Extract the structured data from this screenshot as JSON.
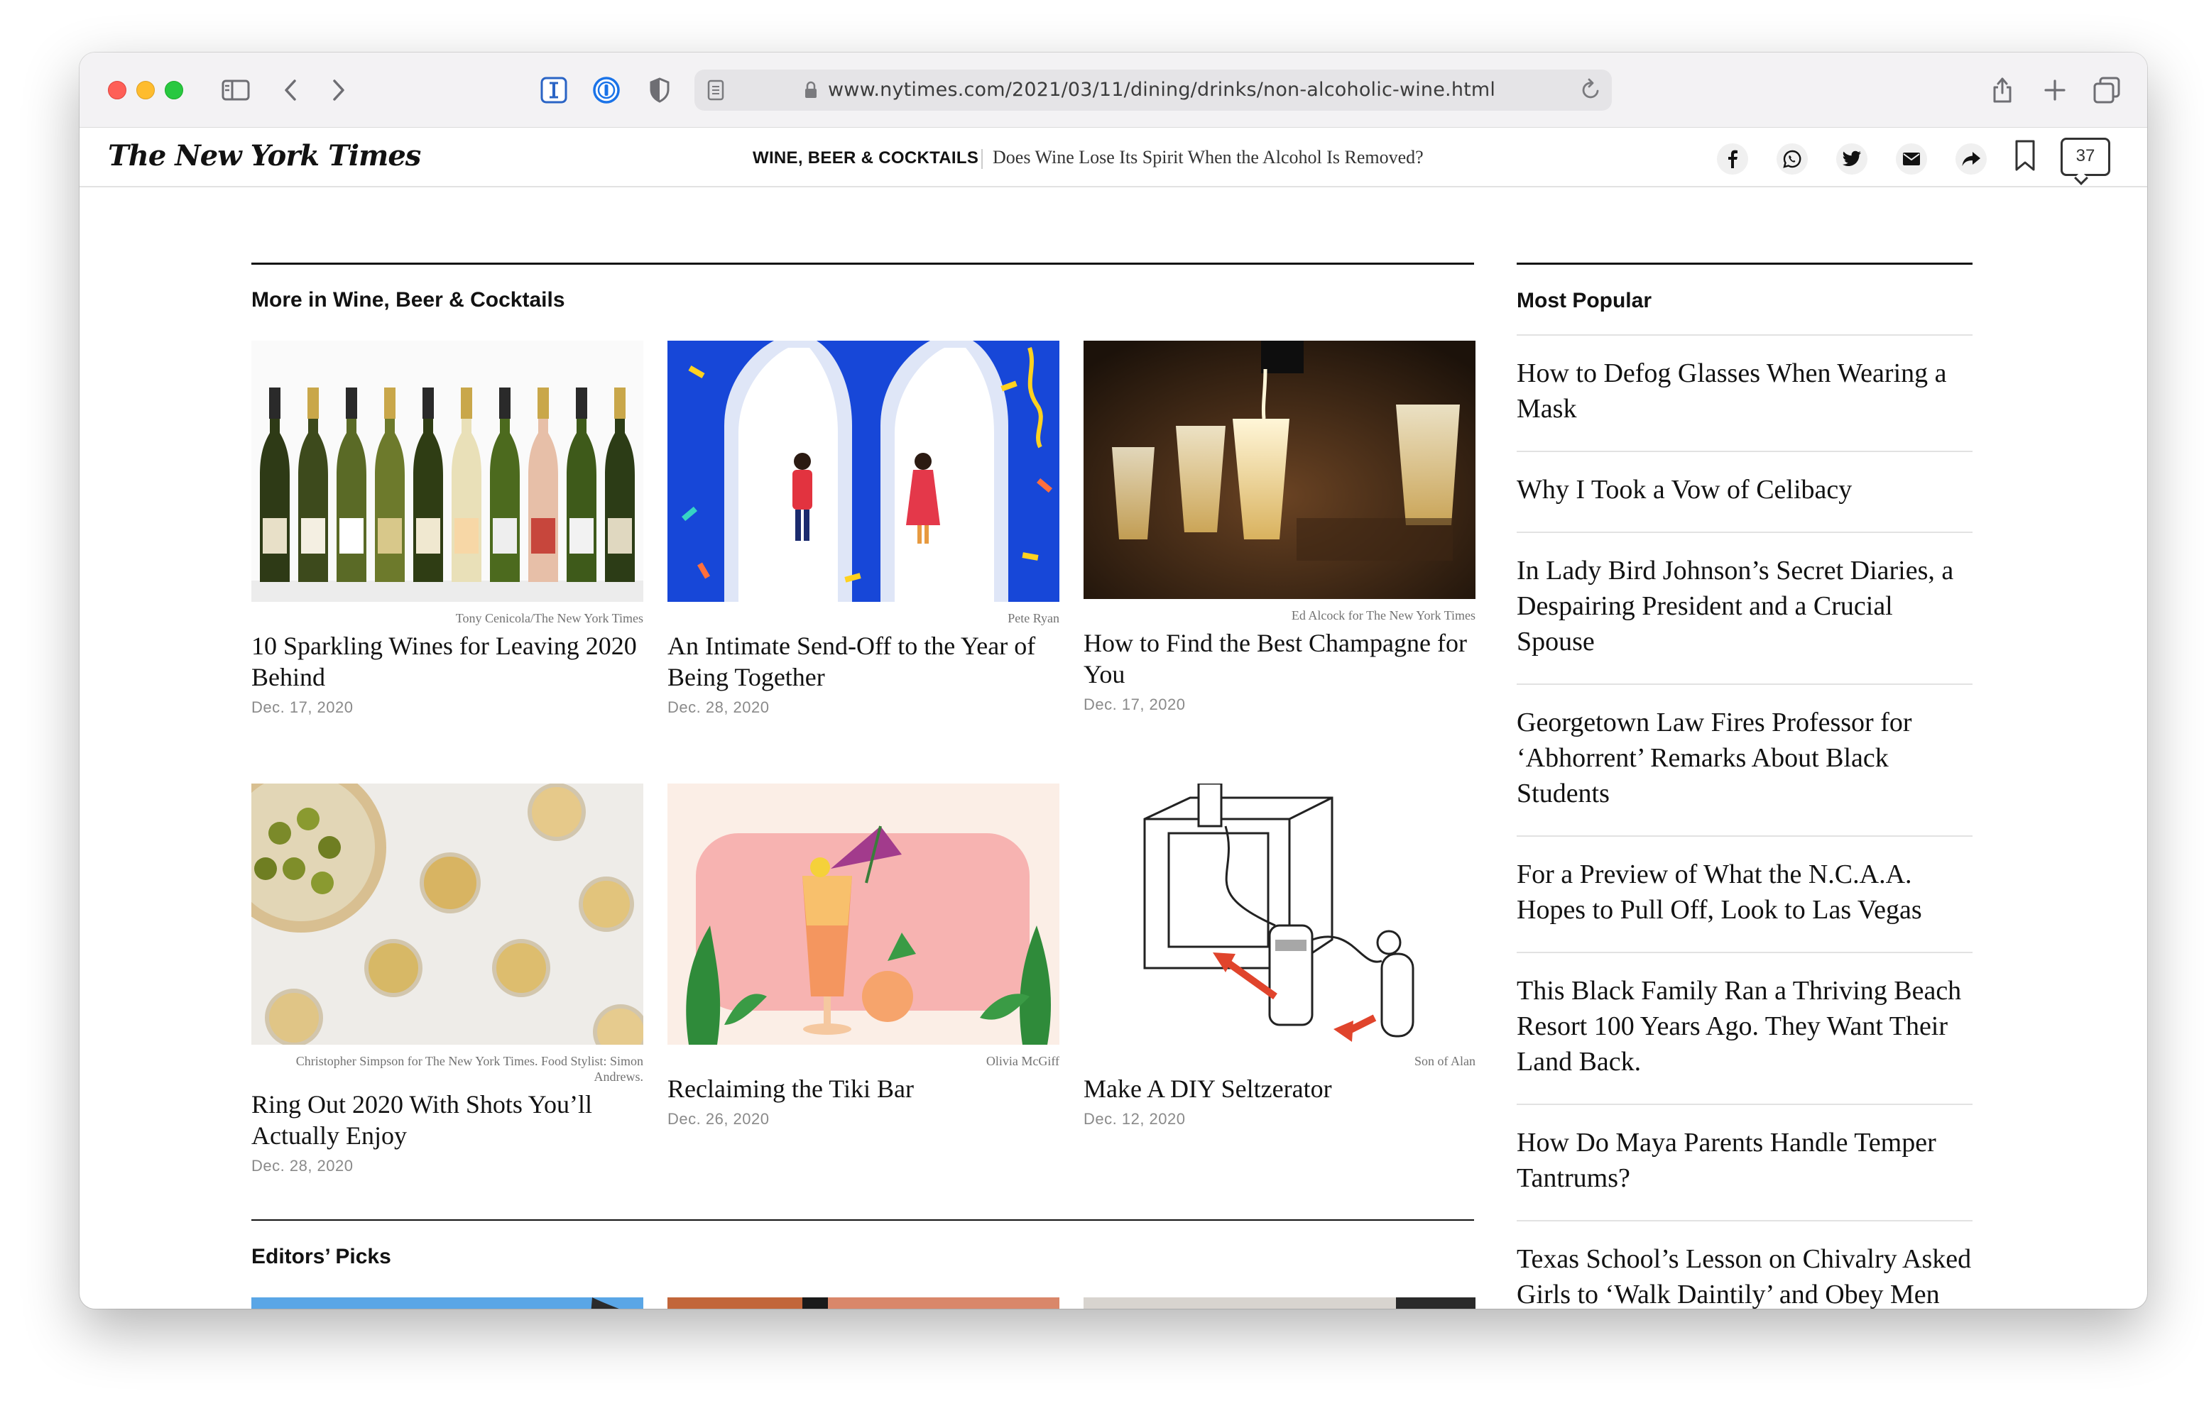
{
  "browser": {
    "url": "www.nytimes.com/2021/03/11/dining/drinks/non-alcoholic-wine.html"
  },
  "header": {
    "logo": "The New York Times",
    "section": "WINE, BEER & COCKTAILS",
    "headline": "Does Wine Lose Its Spirit When the Alcohol Is Removed?",
    "comment_count": "37"
  },
  "more_section": {
    "title": "More in Wine, Beer & Cocktails",
    "cards": [
      {
        "credit": "Tony Cenicola/The New York Times",
        "title": "10 Sparkling Wines for Leaving 2020 Behind",
        "date": "Dec. 17, 2020"
      },
      {
        "credit": "Pete Ryan",
        "title": "An Intimate Send-Off to the Year of Being Together",
        "date": "Dec. 28, 2020"
      },
      {
        "credit": "Ed Alcock for The New York Times",
        "title": "How to Find the Best Champagne for You",
        "date": "Dec. 17, 2020"
      },
      {
        "credit": "Christopher Simpson for The New York Times. Food Stylist: Simon Andrews.",
        "title": "Ring Out 2020 With Shots You’ll Actually Enjoy",
        "date": "Dec. 28, 2020"
      },
      {
        "credit": "Olivia McGiff",
        "title": "Reclaiming the Tiki Bar",
        "date": "Dec. 26, 2020"
      },
      {
        "credit": "Son of Alan",
        "title": "Make A DIY Seltzerator",
        "date": "Dec. 12, 2020"
      }
    ]
  },
  "editors_picks": {
    "title": "Editors’ Picks"
  },
  "most_popular": {
    "title": "Most Popular",
    "items": [
      "How to Defog Glasses When Wearing a Mask",
      "Why I Took a Vow of Celibacy",
      "In Lady Bird Johnson’s Secret Diaries, a Despairing President and a Crucial Spouse",
      "Georgetown Law Fires Professor for ‘Abhorrent’ Remarks About Black Students",
      "For a Preview of What the N.C.A.A. Hopes to Pull Off, Look to Las Vegas",
      "This Black Family Ran a Thriving Beach Resort 100 Years Ago. They Want Their Land Back.",
      "How Do Maya Parents Handle Temper Tantrums?",
      "Texas School’s Lesson on Chivalry Asked Girls to ‘Walk Daintily’ and Obey Men"
    ]
  },
  "icons": {
    "toolbar": [
      "sidebar-icon",
      "back-icon",
      "forward-icon",
      "instapaper-icon",
      "onepassword-icon",
      "privacy-shield-icon",
      "reader-icon",
      "lock-icon",
      "reload-icon",
      "share-icon",
      "new-tab-icon",
      "tab-overview-icon"
    ],
    "share": [
      "facebook-icon",
      "whatsapp-icon",
      "twitter-icon",
      "email-icon",
      "share-arrow-icon",
      "bookmark-icon",
      "comment-icon"
    ]
  }
}
